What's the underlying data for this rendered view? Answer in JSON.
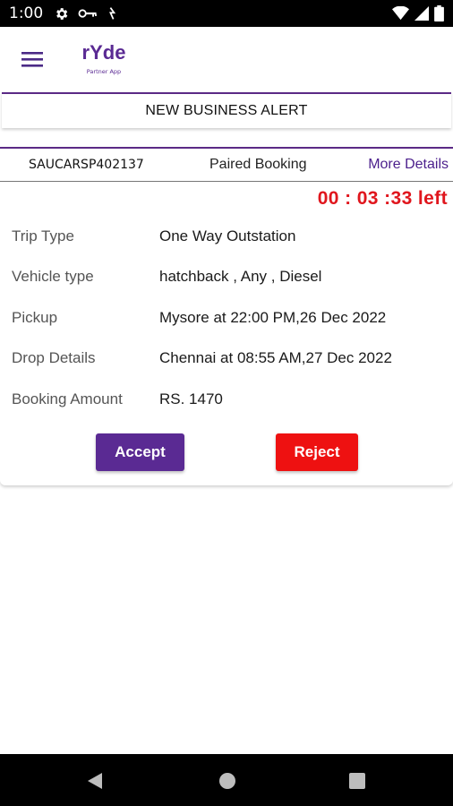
{
  "status_bar": {
    "time": "1:00",
    "left_icons": [
      "gear-icon",
      "key-icon",
      "data-icon"
    ],
    "right_icons": [
      "wifi-icon",
      "signal-icon",
      "battery-icon"
    ]
  },
  "app_bar": {
    "logo_text": "rYde",
    "logo_subtext": "Partner App"
  },
  "alert": {
    "title": "NEW BUSINESS ALERT"
  },
  "booking": {
    "id": "SAUCARSP402137",
    "type_label": "Paired Booking",
    "more_details_label": "More Details",
    "timer": "00 : 03 :33 left",
    "details": [
      {
        "label": "Trip Type",
        "value": "One Way Outstation"
      },
      {
        "label": "Vehicle type",
        "value": "hatchback , Any , Diesel"
      },
      {
        "label": "Pickup",
        "value": "Mysore at 22:00 PM,26 Dec 2022"
      },
      {
        "label": "Drop Details",
        "value": "Chennai at 08:55 AM,27 Dec 2022"
      },
      {
        "label": "Booking Amount",
        "value": "RS. 1470"
      }
    ],
    "accept_label": "Accept",
    "reject_label": "Reject"
  },
  "colors": {
    "brand_purple": "#5a2a93",
    "reject_red": "#ee1111",
    "timer_red": "#e0161d"
  }
}
